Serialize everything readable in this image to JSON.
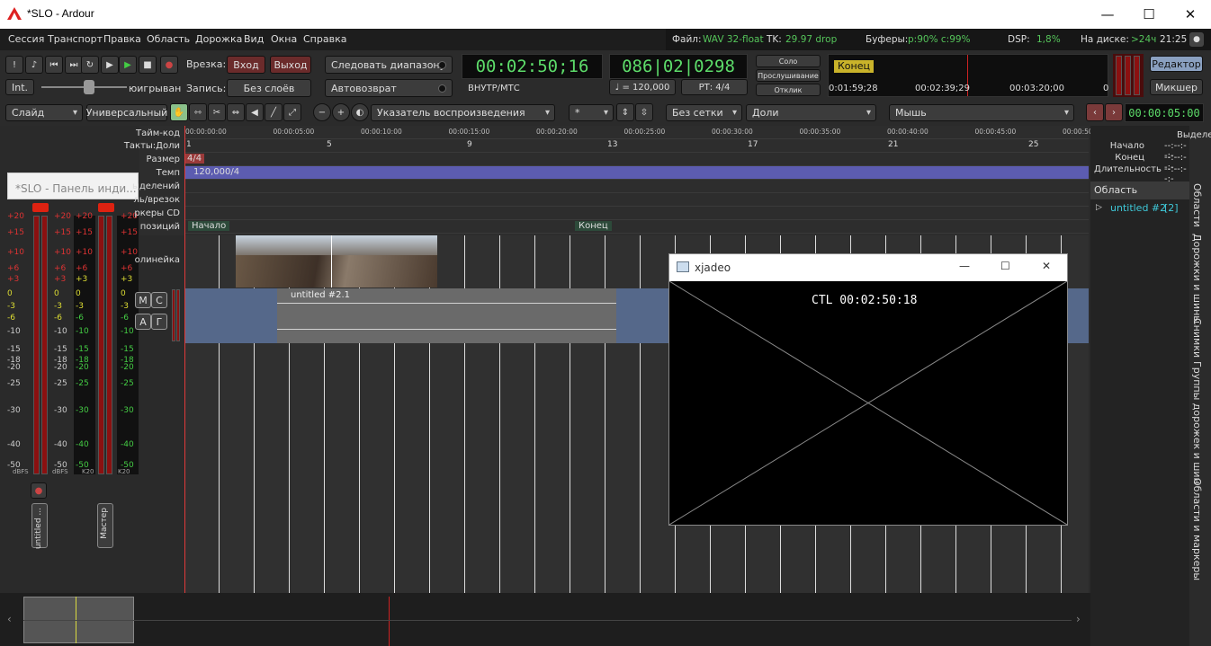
{
  "window": {
    "title": "*SLO - Ardour",
    "min": "—",
    "max": "☐",
    "close": "✕"
  },
  "menu": [
    "Сессия",
    "Транспорт",
    "Правка",
    "Область",
    "Дорожка",
    "Вид",
    "Окна",
    "Справка"
  ],
  "status": {
    "file_label": "Файл:",
    "file_value": "WAV 32-float",
    "tc_label": "TK:",
    "tc_value": "29.97 drop",
    "buffers_label": "Буферы:",
    "buffers_value": "p:90% c:99%",
    "dsp_label": "DSP:",
    "dsp_value": "1,8%",
    "disk_label": "На диске:",
    "disk_value": ">24ч",
    "time": "21:25"
  },
  "transport": {
    "int": "Int.",
    "shuttle_label": "юигрыван",
    "punch_label": "Врезка:",
    "in": "Вход",
    "out": "Выход",
    "rec_label": "Запись:",
    "layers": "Без слоёв",
    "follow": "Следовать диапазону",
    "autoreturn": "Автовозврат",
    "primary_clock": "00:02:50;16",
    "clock_mode": "ВНУТР/МТС",
    "secondary_clock": "086|02|0298",
    "tempo": "♩ = 120,000",
    "meter": "РТ: 4/4",
    "solo": "Соло",
    "audition": "Прослушивание",
    "feedback": "Отклик",
    "mini_end": "Конец",
    "mini_t1": "0:01:59;28",
    "mini_t2": "00:02:39;29",
    "mini_t3": "00:03:20;00",
    "mini_t4": "0",
    "editor": "Редактор",
    "mixer": "Микшер"
  },
  "toolbar2": {
    "mode": "Слайд",
    "ripple": "Универсальный",
    "pointer": "Указатель воспроизведения",
    "nudge": "*",
    "grid": "Без сетки",
    "grid_unit": "Доли",
    "tool": "Мышь",
    "nudge_clock": "00:00:05:00"
  },
  "rulers": {
    "labels": [
      "Тайм-код",
      "Такты:Доли",
      "Размер",
      "Темп",
      "ыделений",
      "ль/врезок",
      "ркеры CD",
      "позиций",
      "олинейка"
    ],
    "timecodes": [
      "00:00:00:00",
      "00:00:05:00",
      "00:00:10:00",
      "00:00:15:00",
      "00:00:20:00",
      "00:00:25:00",
      "00:00:30:00",
      "00:00:35:00",
      "00:00:40:00",
      "00:00:45:00",
      "00:00:50"
    ],
    "bars": [
      "1",
      "5",
      "9",
      "13",
      "17",
      "21",
      "25"
    ],
    "meter": "4/4",
    "tempo": "120,000/4",
    "start_marker": "Начало",
    "end_marker": "Конец"
  },
  "tooltip": "*SLO - Панель инди...",
  "meters": {
    "left_scale": [
      "+20",
      "+15",
      "+10",
      "+6",
      "+3",
      "0",
      "-3",
      "-6",
      "-10",
      "-15",
      "-18",
      "-20",
      "-25",
      "-30",
      "-40",
      "-50"
    ],
    "dbfs": "dBFS",
    "k20": "K20",
    "strip1": "untitled ...",
    "strip2": "Мастер"
  },
  "track": {
    "region": "untitled #2.1",
    "m": "М",
    "s": "С",
    "a": "А",
    "g": "Г"
  },
  "selection": {
    "header": "Выделе",
    "start": "Начало",
    "end": "Конец",
    "length": "Длительность",
    "start_val": "--:--:--:-",
    "end_val": "--:--:--:-",
    "length_val": "--:--:--:-",
    "regions_header": "Область",
    "region_item": "untitled #2",
    "region_count": "[2]"
  },
  "sidetabs": [
    "Области",
    "Дорожки и шины",
    "Снимки",
    "Группы дорожек и шин",
    "Области и маркеры"
  ],
  "xjadeo": {
    "title": "xjadeo",
    "ctl": "CTL  00:02:50:18"
  }
}
